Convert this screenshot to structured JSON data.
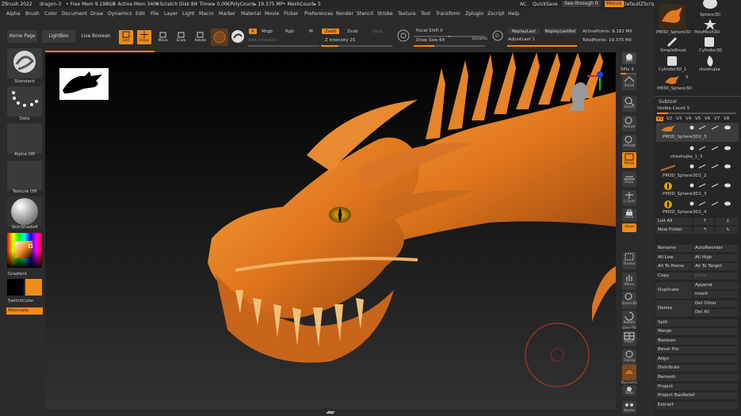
{
  "titlebar": {
    "app": "ZBrush 2022",
    "doc": "dragon-3",
    "free_mem": "• Free Mem 9.198GB",
    "active_mem": "• Active Mem 3409",
    "scratch_disk": "• Scratch Disk 80",
    "timer": "• Timer▸ 0.001",
    "poly_count": "• PolyCount▸ 19.375 MP",
    "mesh_count": "• MeshCount▸ 5",
    "ac": "AC",
    "quicksave": "QuickSave",
    "see_through": "See-through  0",
    "menus": "Menus",
    "script": "DefaultZScript"
  },
  "menus": [
    "Alpha",
    "Brush",
    "Color",
    "Document",
    "Draw",
    "Dynamics",
    "Edit",
    "File",
    "Layer",
    "Light",
    "Macro",
    "Marker",
    "Material",
    "Movie",
    "Picker",
    "Preferences",
    "Render",
    "Stencil",
    "Stroke",
    "Texture",
    "Tool",
    "Transform",
    "Zplugin",
    "Zscript",
    "Help"
  ],
  "topshelf": {
    "home_page": "Home Page",
    "lightbox": "LightBox",
    "live_boolean": "Live Boolean",
    "edit": "Edit",
    "draw": "Draw",
    "move": "Move",
    "scale": "Scale",
    "rotate": "Rotate",
    "a": "A",
    "mrgb": "Mrgb",
    "rgb": "Rgb",
    "m": "M",
    "rgb_intensity": "Rgb Intensity",
    "zadd": "Zadd",
    "zsub": "Zsub",
    "zcut": "Zcut",
    "z_intensity": "Z Intensity 25",
    "focal_shift": "Focal Shift 0",
    "draw_size": "Draw Size 64",
    "dynamic": "Dynamic",
    "replay_last": "ReplayLast",
    "replay_last_rel": "ReplayLastRel",
    "adjust_last": "AdjustLast 1",
    "active_points": "ActivePoints: 9.182 Mil",
    "total_points": "TotalPoints: 19.375 Mil"
  },
  "leftshelf": {
    "standard": "Standard",
    "dots": "Dots",
    "alpha_off": "Alpha Off",
    "texture_off": "Texture Off",
    "material": "SkinShade4",
    "gradient": "Gradient",
    "switch_color": "SwitchColor",
    "alternate": "Alternate",
    "colors": {
      "accent": "#f08a1a",
      "main_color": "#f08a1a",
      "secondary": "#000000"
    }
  },
  "rightshelf": {
    "bpr": "BPR",
    "spix": "SPix 3",
    "scroll": "Scroll",
    "zoom": "Zoom",
    "actual": "Actual",
    "aahalf": "AAHalf",
    "persp": "Persp",
    "floor": "Floor",
    "lsym": "L.Sym",
    "lock": "Lock",
    "qxyz": "Qxyz",
    "frame": "Frame",
    "move": "Move",
    "zoom3d": "Zoom3D",
    "rotate": "Rotate",
    "line_fill": "Line Fill",
    "polyf": "PolyF",
    "transp": "Transp",
    "dynamic": "Dynamic",
    "solo": "Solo",
    "xpose": "Xpose"
  },
  "rightpanel": {
    "thumbs": [
      "PM3D_Sphere3D",
      "Sphere3D",
      "PM3D_Sphere3D",
      "PolyMesh3D",
      "SimpleBrush",
      "Cylinder3D",
      "Cylinder3D_1",
      "cheshujka",
      "PM3D_Sphere3D"
    ],
    "count_5": "5",
    "subtool": "Subtool",
    "visible_count": "Visible Count 5",
    "versions": [
      "V1",
      "V2",
      "V3",
      "V4",
      "V5",
      "V6",
      "V7",
      "V8"
    ],
    "subtools": [
      "PM3D_Sphere3D2_3",
      "cheshujka_1_3",
      "PM3D_Sphere3D1_2",
      "PM3D_Sphere3D1_3",
      "PM3D_Sphere3D1_4"
    ],
    "list_all": "List All",
    "new_folder": "New Folder",
    "rename": "Rename",
    "auto_reorder": "AutoReorder",
    "all_low": "All Low",
    "all_high": "All High",
    "all_to_home": "All To Home",
    "all_to_target": "All To Target",
    "copy": "Copy",
    "paste": "Paste",
    "duplicate": "Duplicate",
    "append": "Append",
    "insert": "Insert",
    "delete": "Delete",
    "del_other": "Del Other",
    "del_all": "Del All",
    "split": "Split",
    "merge": "Merge",
    "boolean": "Boolean",
    "bevel_pro": "Bevel Pro",
    "align": "Align",
    "distribute": "Distribute",
    "remesh": "Remesh",
    "project": "Project",
    "project_basrelief": "Project BasRelief",
    "extract": "Extract"
  }
}
